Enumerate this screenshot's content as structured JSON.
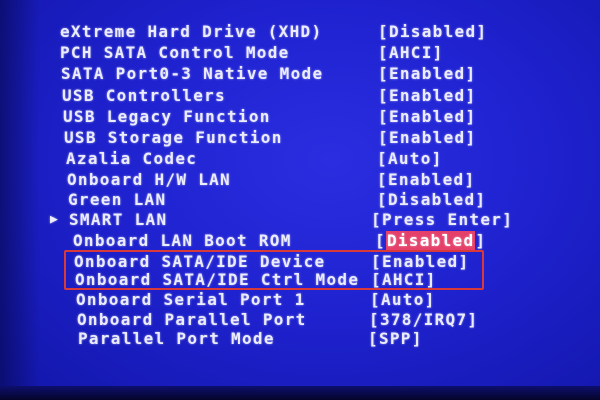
{
  "bios": {
    "items": [
      {
        "label": "eXtreme Hard Drive (XHD)",
        "value": "Disabled"
      },
      {
        "label": "PCH SATA Control Mode",
        "value": "AHCI"
      },
      {
        "label": "SATA Port0-3 Native Mode",
        "value": "Enabled"
      },
      {
        "label": "USB Controllers",
        "value": "Enabled"
      },
      {
        "label": "USB Legacy Function",
        "value": "Enabled"
      },
      {
        "label": "USB Storage Function",
        "value": "Enabled"
      },
      {
        "label": "Azalia Codec",
        "value": "Auto"
      },
      {
        "label": "Onboard H/W LAN",
        "value": "Enabled"
      },
      {
        "label": "Green LAN",
        "value": "Disabled"
      },
      {
        "label": "SMART LAN",
        "value": "Press Enter"
      },
      {
        "label": "Onboard LAN Boot ROM",
        "value": "Disabled"
      },
      {
        "label": "Onboard SATA/IDE Device",
        "value": "Enabled"
      },
      {
        "label": "Onboard SATA/IDE Ctrl Mode",
        "value": "AHCI"
      },
      {
        "label": "Onboard Serial Port 1",
        "value": "Auto"
      },
      {
        "label": "Onboard Parallel Port",
        "value": "378/IRQ7"
      },
      {
        "label": "Parallel Port Mode",
        "value": "SPP"
      }
    ],
    "submenu_arrow": "▶",
    "colors": {
      "background": "#1d1fc4",
      "text": "#ececff",
      "selection": "#e4406a",
      "annotation_box": "#d83a3a"
    }
  }
}
